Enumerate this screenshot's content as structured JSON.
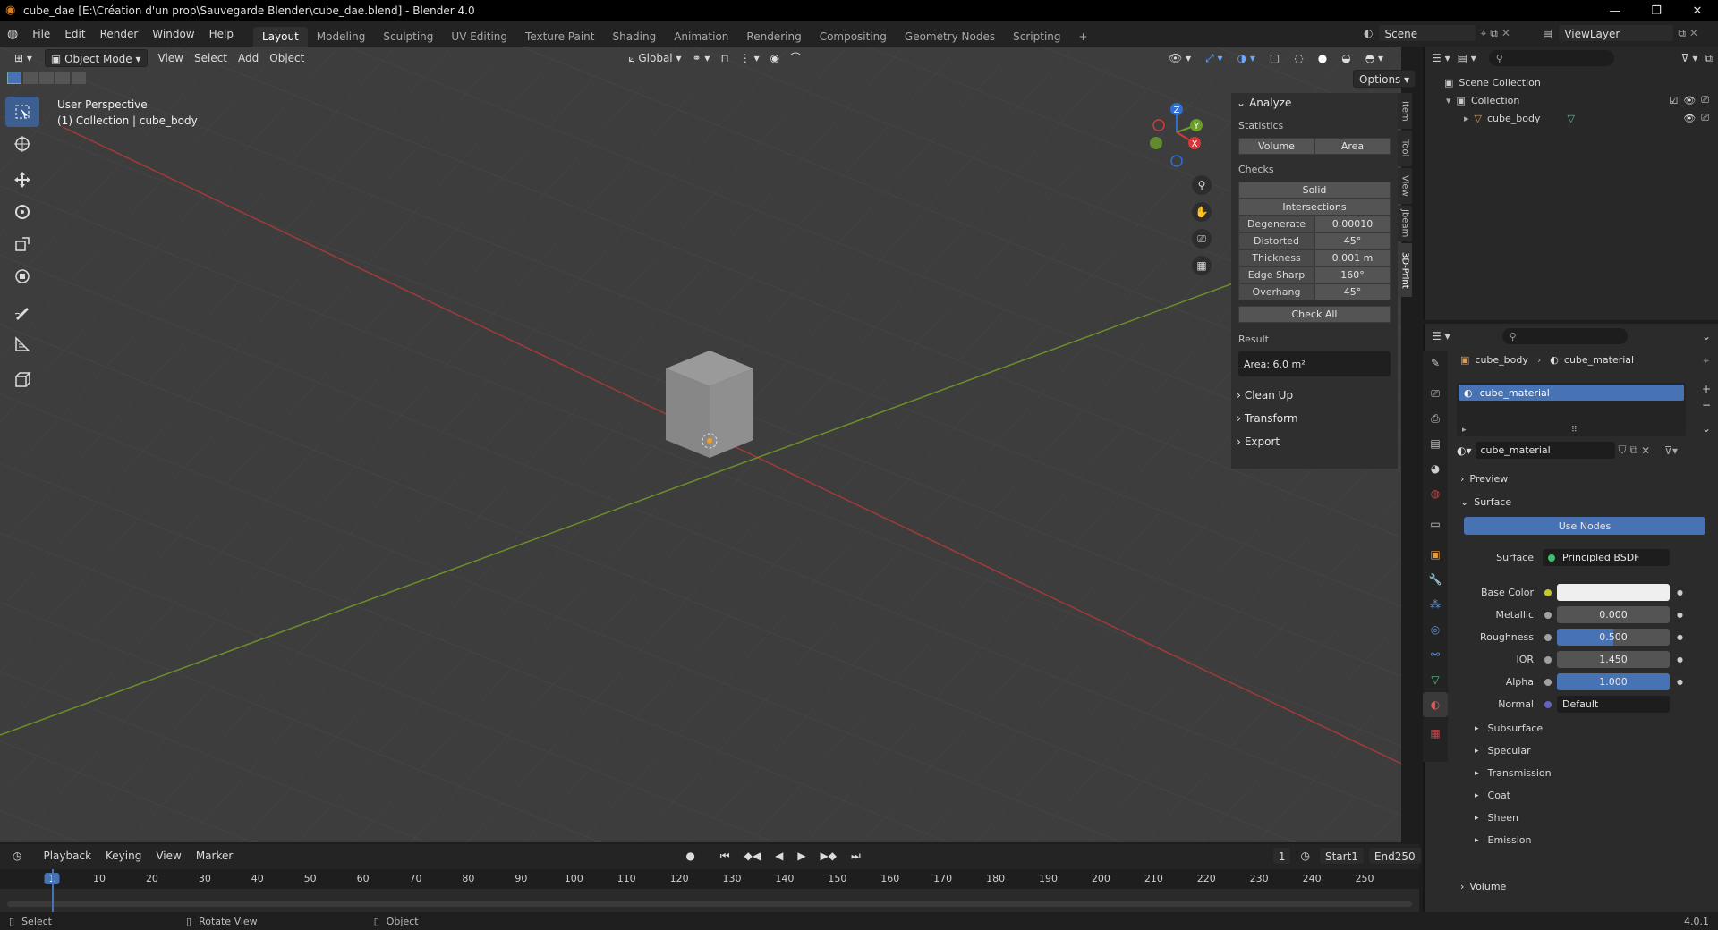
{
  "window": {
    "title": "cube_dae [E:\\Création d'un prop\\Sauvegarde Blender\\cube_dae.blend] - Blender 4.0",
    "controls": [
      "—",
      "❐",
      "✕"
    ]
  },
  "menu": [
    "File",
    "Edit",
    "Render",
    "Window",
    "Help"
  ],
  "workspaces": [
    "Layout",
    "Modeling",
    "Sculpting",
    "UV Editing",
    "Texture Paint",
    "Shading",
    "Animation",
    "Rendering",
    "Compositing",
    "Geometry Nodes",
    "Scripting"
  ],
  "workspace_add": "+",
  "scene": {
    "name": "Scene",
    "view_layer": "ViewLayer"
  },
  "viewport_header": {
    "mode": "Object Mode",
    "menus": [
      "View",
      "Select",
      "Add",
      "Object"
    ],
    "orientation": "Global",
    "options": "Options"
  },
  "viewport": {
    "perspective": "User Perspective",
    "collection_info": "(1) Collection | cube_body",
    "gizmo": {
      "x": "X",
      "y": "Y",
      "z": "Z"
    }
  },
  "npanel": {
    "tabs": [
      "Item",
      "Tool",
      "View",
      "Jbeam",
      "3D-Print"
    ],
    "analyze": "Analyze",
    "statistics": "Statistics",
    "stat_buttons": [
      "Volume",
      "Area"
    ],
    "checks": "Checks",
    "solid": "Solid",
    "intersections": "Intersections",
    "check_rows": [
      {
        "label": "Degenerate",
        "value": "0.00010"
      },
      {
        "label": "Distorted",
        "value": "45°"
      },
      {
        "label": "Thickness",
        "value": "0.001 m"
      },
      {
        "label": "Edge Sharp",
        "value": "160°"
      },
      {
        "label": "Overhang",
        "value": "45°"
      }
    ],
    "check_all": "Check All",
    "result_label": "Result",
    "result_value": "Area: 6.0 m²",
    "collapsed": [
      "Clean Up",
      "Transform",
      "Export"
    ]
  },
  "outliner": {
    "root": "Scene Collection",
    "collection": "Collection",
    "object": "cube_body"
  },
  "properties": {
    "breadcrumb_object": "cube_body",
    "breadcrumb_material": "cube_material",
    "slot": "cube_material",
    "material_name": "cube_material",
    "preview": "Preview",
    "surface_section": "Surface",
    "use_nodes": "Use Nodes",
    "surface_label": "Surface",
    "surface_value": "Principled BSDF",
    "inputs": [
      {
        "label": "Base Color",
        "value": "",
        "socket": "#c7c729",
        "style": "white"
      },
      {
        "label": "Metallic",
        "value": "0.000",
        "socket": "#a1a1a1",
        "style": "grey"
      },
      {
        "label": "Roughness",
        "value": "0.500",
        "socket": "#a1a1a1",
        "style": "half"
      },
      {
        "label": "IOR",
        "value": "1.450",
        "socket": "#a1a1a1",
        "style": "grey"
      },
      {
        "label": "Alpha",
        "value": "1.000",
        "socket": "#a1a1a1",
        "style": "blue"
      },
      {
        "label": "Normal",
        "value": "Default",
        "socket": "#6363c7",
        "style": "dark"
      }
    ],
    "subsections": [
      "Subsurface",
      "Specular",
      "Transmission",
      "Coat",
      "Sheen",
      "Emission"
    ],
    "volume": "Volume"
  },
  "timeline": {
    "menus": [
      "Playback",
      "Keying",
      "View",
      "Marker"
    ],
    "current_frame": "1",
    "start_label": "Start",
    "start": "1",
    "end_label": "End",
    "end": "250",
    "ticks": [
      "1",
      "10",
      "20",
      "30",
      "40",
      "50",
      "60",
      "70",
      "80",
      "90",
      "100",
      "110",
      "120",
      "130",
      "140",
      "150",
      "160",
      "170",
      "180",
      "190",
      "200",
      "210",
      "220",
      "230",
      "240",
      "250"
    ]
  },
  "status": {
    "select": "Select",
    "rotate": "Rotate View",
    "object": "Object",
    "version": "4.0.1"
  }
}
